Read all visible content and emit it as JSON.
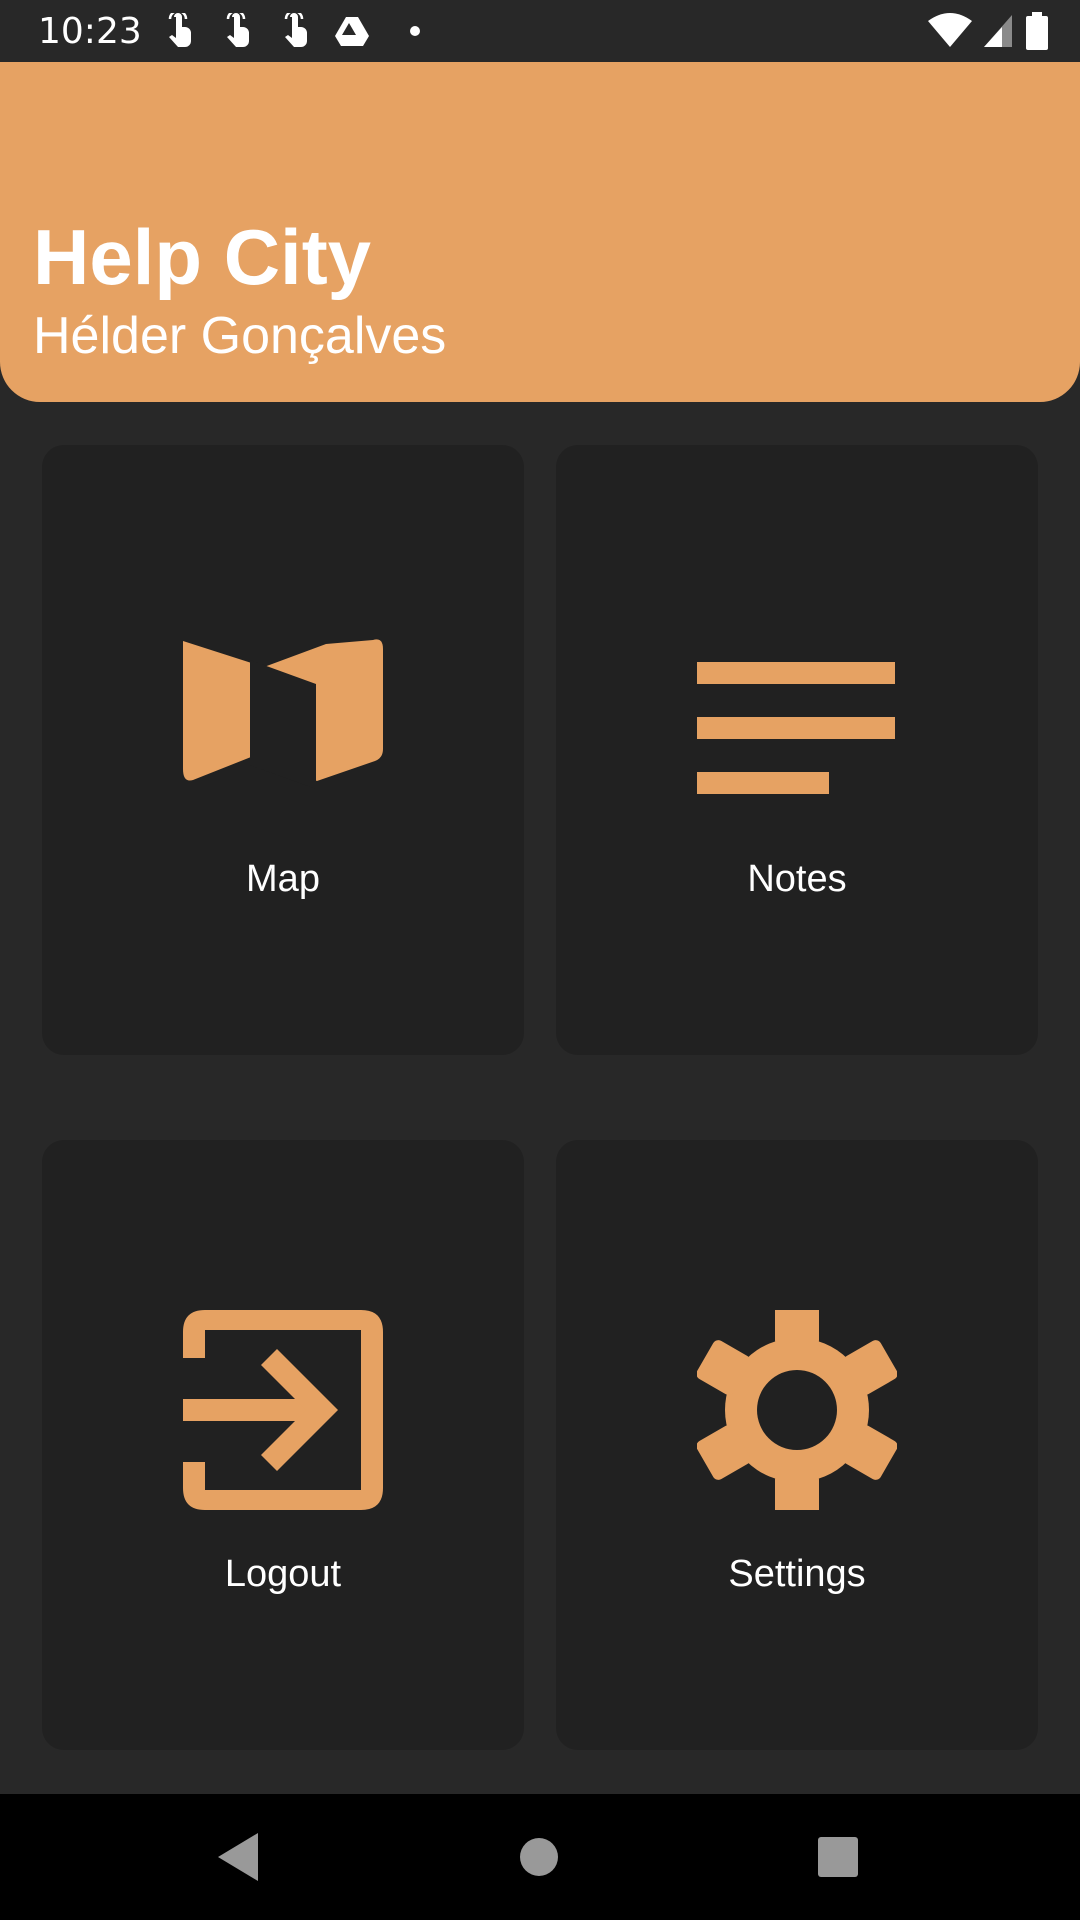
{
  "status_bar": {
    "time": "10:23",
    "notification_icons": [
      "touch-icon",
      "touch-icon",
      "touch-icon",
      "drive-icon",
      "dot-icon"
    ],
    "system_icons": [
      "wifi-icon",
      "signal-icon",
      "battery-icon"
    ]
  },
  "header": {
    "title": "Help City",
    "user_name": "Hélder Gonçalves",
    "background_color": "#E6A263"
  },
  "menu": {
    "accent_color": "#E6A263",
    "tiles": [
      {
        "label": "Map",
        "icon": "map-icon"
      },
      {
        "label": "Notes",
        "icon": "notes-icon"
      },
      {
        "label": "Logout",
        "icon": "logout-icon"
      },
      {
        "label": "Settings",
        "icon": "gear-icon"
      }
    ]
  },
  "nav_bar": {
    "buttons": [
      "back-icon",
      "home-icon",
      "recents-icon"
    ]
  }
}
